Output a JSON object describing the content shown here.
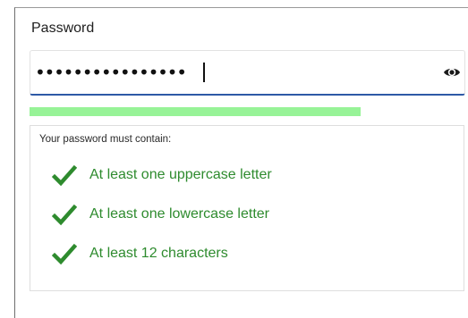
{
  "password": {
    "label": "Password",
    "value": "••••••••••••••••",
    "toggle_icon": "eye-icon"
  },
  "strength": {
    "fraction": 0.76,
    "color": "#97f397"
  },
  "requirements": {
    "title": "Your password must contain:",
    "status_color": "#2e8b2e",
    "items": [
      {
        "label": "At least one uppercase letter",
        "icon": "check-icon",
        "met": true
      },
      {
        "label": "At least one lowercase letter",
        "icon": "check-icon",
        "met": true
      },
      {
        "label": "At least 12 characters",
        "icon": "check-icon",
        "met": true
      }
    ]
  }
}
